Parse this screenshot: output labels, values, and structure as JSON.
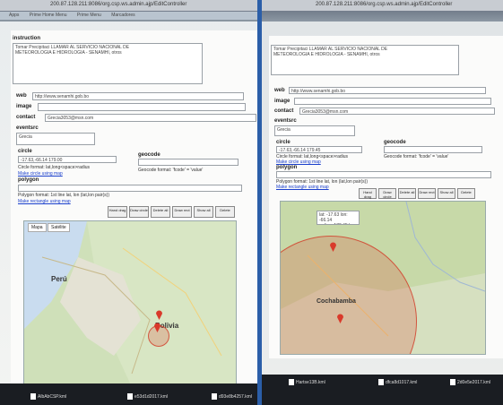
{
  "left": {
    "url": "200.87.128.211:8086/org.csp.ws.admin.ajp/EditController",
    "bookmarks": [
      "Apps",
      "Prime Home Menu",
      "Prime Menu",
      "Marcadores"
    ],
    "instruction_label": "instruction",
    "instruction_text": "Tomar Precipitaci LLAMAR AL SERVICIO NACIONAL DE\nMETEOROLOGIA E HIDROLOGIA - SENAMHI, otros",
    "web_label": "web",
    "web_value": "http://www.senamhi.gob.bo",
    "image_label": "image",
    "contact_label": "contact",
    "contact_value": "Grecia3053@msn.com",
    "eventsource_label": "eventsrc",
    "eventsource_value": "Grecia",
    "circle_label": "circle",
    "circle_value": "-17.63,-66.14 179.00",
    "circle_format": "Circle format: lat,long<space>radius",
    "make_circle": "Make circle using map",
    "geocode_label": "geocode",
    "geocode_format": "Geocode format: 'fcode' = 'value'",
    "polygon_label": "polygon",
    "polygon_format": "Polygon format: 1st line lat, lon  (lat,lon pair(s))",
    "make_rect": "Make rectangle using map",
    "map_buttons": [
      "Hand drag",
      "Draw circle",
      "Delete all",
      "Draw rect",
      "Show all",
      "Delete"
    ],
    "map_tabs": [
      "Mapa",
      "Satélite"
    ],
    "country_label": "Perú",
    "place_label": "Bolivia",
    "taskbar": [
      "AlbAbCSP.kml",
      "e53d1d2017.kml",
      "d93e8b4257.kml"
    ]
  },
  "right": {
    "url": "200.87.128.211:8086/org.csp.ws.admin.ajp/EditController",
    "instruction_text": "Tomar Precipitaci LLAMAR AL SERVICIO NACIONAL DE\nMETEOROLOGIA E HIDROLOGIA - SENAMHI, otros",
    "web_label": "web",
    "web_value": "http://www.senamhi.gob.bo",
    "image_label": "image",
    "contact_label": "contact",
    "contact_value": "Grecia3053@msn.com",
    "eventsource_label": "eventsrc",
    "eventsource_value": "Grecia",
    "circle_label": "circle",
    "circle_value": "-17.63,-66.14 179.45",
    "circle_format": "Circle format: lat,long<space>radius",
    "make_circle": "Make circle using map",
    "geocode_label": "geocode",
    "geocode_format": "Geocode format: 'fcode' = 'value'",
    "polygon_label": "polygon",
    "polygon_format": "Polygon format: 1st line lat, lon  (lat,lon pair(s))",
    "make_rect": "Make rectangle using map",
    "map_buttons": [
      "Hand drag",
      "Draw circle",
      "Delete all",
      "Draw rect",
      "Show all",
      "Delete"
    ],
    "popup": "lat: -17.63 lon: -66.14\nradius: 179.45 km",
    "place_label": "Cochabamba",
    "taskbar": [
      "Hartse13B.kml",
      "dfca8d1017.kml",
      "2d0e5e2017.kml"
    ]
  }
}
